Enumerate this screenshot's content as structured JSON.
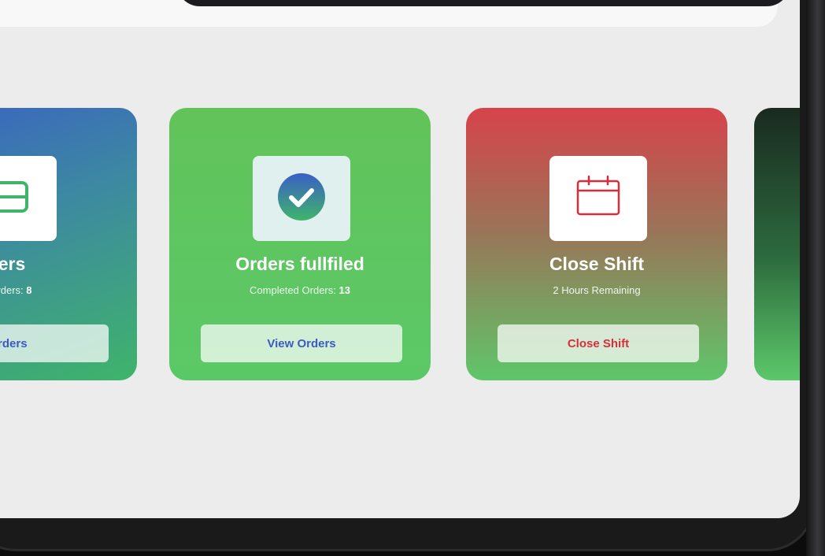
{
  "cards": [
    {
      "id": "pending",
      "title": "ders",
      "subtitle_label": "g Orders: ",
      "subtitle_value": "8",
      "button_label": "Orders",
      "icon": "receipt-icon"
    },
    {
      "id": "fulfilled",
      "title": "Orders fullfiled",
      "subtitle_label": "Completed Orders: ",
      "subtitle_value": "13",
      "button_label": "View Orders",
      "icon": "check-circle-icon"
    },
    {
      "id": "shift",
      "title": "Close Shift",
      "subtitle_label": "2 Hours Remaining",
      "subtitle_value": "",
      "button_label": "Close Shift",
      "icon": "calendar-icon"
    }
  ],
  "colors": {
    "blue_accent": "#3b5bc4",
    "green_accent": "#5bc867",
    "red_accent": "#d72f3a",
    "background": "#ececec"
  }
}
